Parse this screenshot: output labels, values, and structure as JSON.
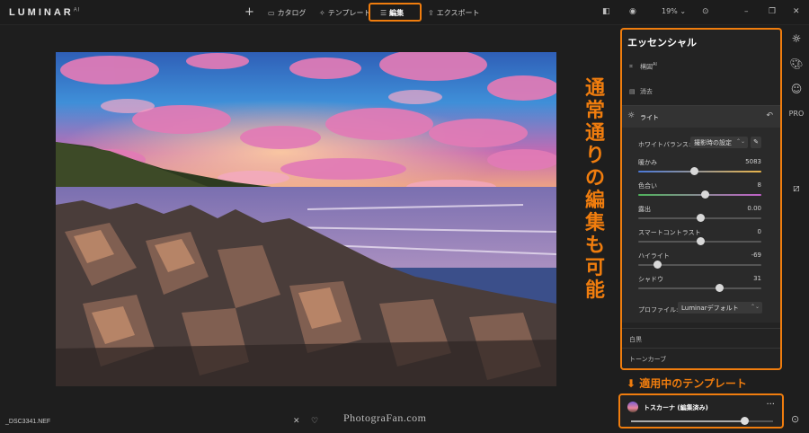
{
  "app": {
    "logo": "LUMINAR",
    "logo_sup": "AI"
  },
  "topbar": {
    "add_icon": "plus-icon",
    "catalog_label": "カタログ",
    "template_label": "テンプレート",
    "edit_label": "編集",
    "export_label": "エクスポート",
    "zoom": "19%"
  },
  "image": {
    "filename": "_DSC3341.NEF"
  },
  "watermark": "PhotograFan.com",
  "annotations": {
    "edit_note": "通常通りの編集も可能",
    "template_note": "⬇ 適用中のテンプレート"
  },
  "panel": {
    "title": "エッセンシャル",
    "crop_label": "構図",
    "crop_sup": "AI",
    "erase_label": "消去",
    "light": {
      "title": "ライト",
      "wb_label": "ホワイトバランス:",
      "wb_value": "撮影時の設定",
      "sliders": [
        {
          "label": "暖かみ",
          "value": "5083",
          "position": 0.45
        },
        {
          "label": "色合い",
          "value": "8",
          "position": 0.54
        },
        {
          "label": "露出",
          "value": "0.00",
          "position": 0.5
        },
        {
          "label": "スマートコントラスト",
          "value": "0",
          "position": 0.5
        },
        {
          "label": "ハイライト",
          "value": "-69",
          "position": 0.155
        },
        {
          "label": "シャドウ",
          "value": "31",
          "position": 0.655
        }
      ],
      "profile_label": "プロファイル:",
      "profile_value": "Luminarデフォルト"
    },
    "bw_label": "白黒",
    "tone_curve_label": "トーンカーブ"
  },
  "template": {
    "name": "トスカーナ (編集済み)",
    "amount": 0.8
  }
}
